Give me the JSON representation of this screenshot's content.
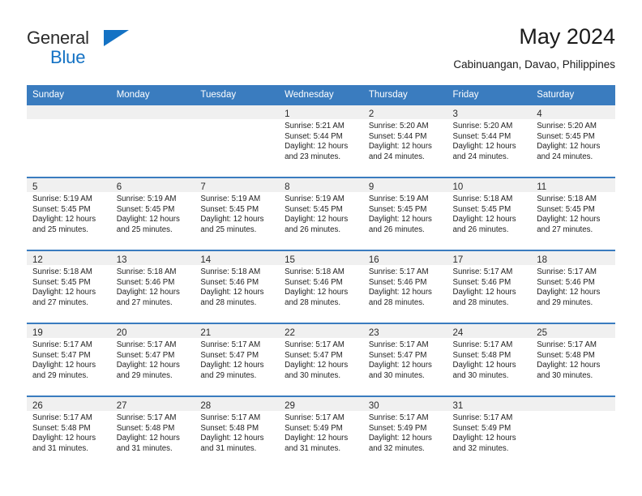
{
  "brand": {
    "name_top": "General",
    "name_bottom": "Blue",
    "accent_color": "#1472c4"
  },
  "header": {
    "title": "May 2024",
    "subtitle": "Cabinuangan, Davao, Philippines"
  },
  "theme": {
    "header_row_bg": "#3a7cbf",
    "date_band_bg": "#f0f0f0",
    "week_separator": "#3a7cbf",
    "text": "#1f1f1f"
  },
  "weekday_headers": [
    "Sunday",
    "Monday",
    "Tuesday",
    "Wednesday",
    "Thursday",
    "Friday",
    "Saturday"
  ],
  "labels": {
    "sunrise_prefix": "Sunrise:",
    "sunset_prefix": "Sunset:",
    "daylight_prefix": "Daylight:"
  },
  "weeks": [
    [
      {
        "empty": true
      },
      {
        "empty": true
      },
      {
        "empty": true
      },
      {
        "date": "1",
        "sunrise": "Sunrise: 5:21 AM",
        "sunset": "Sunset: 5:44 PM",
        "daylight_1": "Daylight: 12 hours",
        "daylight_2": "and 23 minutes."
      },
      {
        "date": "2",
        "sunrise": "Sunrise: 5:20 AM",
        "sunset": "Sunset: 5:44 PM",
        "daylight_1": "Daylight: 12 hours",
        "daylight_2": "and 24 minutes."
      },
      {
        "date": "3",
        "sunrise": "Sunrise: 5:20 AM",
        "sunset": "Sunset: 5:44 PM",
        "daylight_1": "Daylight: 12 hours",
        "daylight_2": "and 24 minutes."
      },
      {
        "date": "4",
        "sunrise": "Sunrise: 5:20 AM",
        "sunset": "Sunset: 5:45 PM",
        "daylight_1": "Daylight: 12 hours",
        "daylight_2": "and 24 minutes."
      }
    ],
    [
      {
        "date": "5",
        "sunrise": "Sunrise: 5:19 AM",
        "sunset": "Sunset: 5:45 PM",
        "daylight_1": "Daylight: 12 hours",
        "daylight_2": "and 25 minutes."
      },
      {
        "date": "6",
        "sunrise": "Sunrise: 5:19 AM",
        "sunset": "Sunset: 5:45 PM",
        "daylight_1": "Daylight: 12 hours",
        "daylight_2": "and 25 minutes."
      },
      {
        "date": "7",
        "sunrise": "Sunrise: 5:19 AM",
        "sunset": "Sunset: 5:45 PM",
        "daylight_1": "Daylight: 12 hours",
        "daylight_2": "and 25 minutes."
      },
      {
        "date": "8",
        "sunrise": "Sunrise: 5:19 AM",
        "sunset": "Sunset: 5:45 PM",
        "daylight_1": "Daylight: 12 hours",
        "daylight_2": "and 26 minutes."
      },
      {
        "date": "9",
        "sunrise": "Sunrise: 5:19 AM",
        "sunset": "Sunset: 5:45 PM",
        "daylight_1": "Daylight: 12 hours",
        "daylight_2": "and 26 minutes."
      },
      {
        "date": "10",
        "sunrise": "Sunrise: 5:18 AM",
        "sunset": "Sunset: 5:45 PM",
        "daylight_1": "Daylight: 12 hours",
        "daylight_2": "and 26 minutes."
      },
      {
        "date": "11",
        "sunrise": "Sunrise: 5:18 AM",
        "sunset": "Sunset: 5:45 PM",
        "daylight_1": "Daylight: 12 hours",
        "daylight_2": "and 27 minutes."
      }
    ],
    [
      {
        "date": "12",
        "sunrise": "Sunrise: 5:18 AM",
        "sunset": "Sunset: 5:45 PM",
        "daylight_1": "Daylight: 12 hours",
        "daylight_2": "and 27 minutes."
      },
      {
        "date": "13",
        "sunrise": "Sunrise: 5:18 AM",
        "sunset": "Sunset: 5:46 PM",
        "daylight_1": "Daylight: 12 hours",
        "daylight_2": "and 27 minutes."
      },
      {
        "date": "14",
        "sunrise": "Sunrise: 5:18 AM",
        "sunset": "Sunset: 5:46 PM",
        "daylight_1": "Daylight: 12 hours",
        "daylight_2": "and 28 minutes."
      },
      {
        "date": "15",
        "sunrise": "Sunrise: 5:18 AM",
        "sunset": "Sunset: 5:46 PM",
        "daylight_1": "Daylight: 12 hours",
        "daylight_2": "and 28 minutes."
      },
      {
        "date": "16",
        "sunrise": "Sunrise: 5:17 AM",
        "sunset": "Sunset: 5:46 PM",
        "daylight_1": "Daylight: 12 hours",
        "daylight_2": "and 28 minutes."
      },
      {
        "date": "17",
        "sunrise": "Sunrise: 5:17 AM",
        "sunset": "Sunset: 5:46 PM",
        "daylight_1": "Daylight: 12 hours",
        "daylight_2": "and 28 minutes."
      },
      {
        "date": "18",
        "sunrise": "Sunrise: 5:17 AM",
        "sunset": "Sunset: 5:46 PM",
        "daylight_1": "Daylight: 12 hours",
        "daylight_2": "and 29 minutes."
      }
    ],
    [
      {
        "date": "19",
        "sunrise": "Sunrise: 5:17 AM",
        "sunset": "Sunset: 5:47 PM",
        "daylight_1": "Daylight: 12 hours",
        "daylight_2": "and 29 minutes."
      },
      {
        "date": "20",
        "sunrise": "Sunrise: 5:17 AM",
        "sunset": "Sunset: 5:47 PM",
        "daylight_1": "Daylight: 12 hours",
        "daylight_2": "and 29 minutes."
      },
      {
        "date": "21",
        "sunrise": "Sunrise: 5:17 AM",
        "sunset": "Sunset: 5:47 PM",
        "daylight_1": "Daylight: 12 hours",
        "daylight_2": "and 29 minutes."
      },
      {
        "date": "22",
        "sunrise": "Sunrise: 5:17 AM",
        "sunset": "Sunset: 5:47 PM",
        "daylight_1": "Daylight: 12 hours",
        "daylight_2": "and 30 minutes."
      },
      {
        "date": "23",
        "sunrise": "Sunrise: 5:17 AM",
        "sunset": "Sunset: 5:47 PM",
        "daylight_1": "Daylight: 12 hours",
        "daylight_2": "and 30 minutes."
      },
      {
        "date": "24",
        "sunrise": "Sunrise: 5:17 AM",
        "sunset": "Sunset: 5:48 PM",
        "daylight_1": "Daylight: 12 hours",
        "daylight_2": "and 30 minutes."
      },
      {
        "date": "25",
        "sunrise": "Sunrise: 5:17 AM",
        "sunset": "Sunset: 5:48 PM",
        "daylight_1": "Daylight: 12 hours",
        "daylight_2": "and 30 minutes."
      }
    ],
    [
      {
        "date": "26",
        "sunrise": "Sunrise: 5:17 AM",
        "sunset": "Sunset: 5:48 PM",
        "daylight_1": "Daylight: 12 hours",
        "daylight_2": "and 31 minutes."
      },
      {
        "date": "27",
        "sunrise": "Sunrise: 5:17 AM",
        "sunset": "Sunset: 5:48 PM",
        "daylight_1": "Daylight: 12 hours",
        "daylight_2": "and 31 minutes."
      },
      {
        "date": "28",
        "sunrise": "Sunrise: 5:17 AM",
        "sunset": "Sunset: 5:48 PM",
        "daylight_1": "Daylight: 12 hours",
        "daylight_2": "and 31 minutes."
      },
      {
        "date": "29",
        "sunrise": "Sunrise: 5:17 AM",
        "sunset": "Sunset: 5:49 PM",
        "daylight_1": "Daylight: 12 hours",
        "daylight_2": "and 31 minutes."
      },
      {
        "date": "30",
        "sunrise": "Sunrise: 5:17 AM",
        "sunset": "Sunset: 5:49 PM",
        "daylight_1": "Daylight: 12 hours",
        "daylight_2": "and 32 minutes."
      },
      {
        "date": "31",
        "sunrise": "Sunrise: 5:17 AM",
        "sunset": "Sunset: 5:49 PM",
        "daylight_1": "Daylight: 12 hours",
        "daylight_2": "and 32 minutes."
      },
      {
        "empty": true
      }
    ]
  ]
}
